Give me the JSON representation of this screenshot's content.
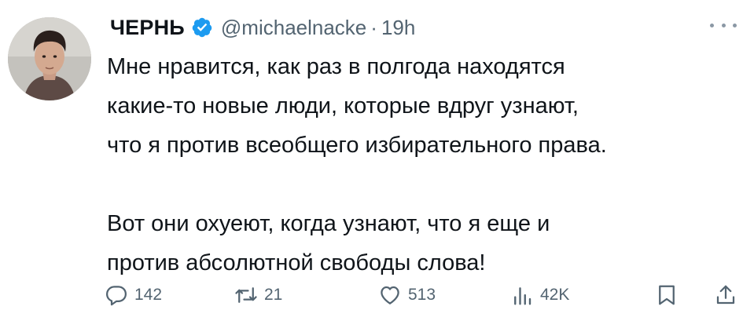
{
  "tweet": {
    "author_name": "ЧЕРНЬ",
    "handle": "@michaelnacke",
    "separator": "·",
    "time": "19h",
    "paragraphs": [
      [
        "Мне нравится, как раз в полгода находятся",
        "какие-то новые люди, которые вдруг узнают,",
        "что я против всеобщего избирательного права."
      ],
      [
        "Вот они охуеют, когда узнают, что я еще и",
        "против абсолютной свободы слова!"
      ]
    ]
  },
  "actions": {
    "replies": "142",
    "reposts": "21",
    "likes": "513",
    "views": "42K"
  },
  "icons": {
    "more": "more-icon",
    "verified": "verified-badge-icon",
    "reply": "reply-icon",
    "repost": "repost-icon",
    "like": "like-icon",
    "views": "views-icon",
    "bookmark": "bookmark-icon",
    "share": "share-icon"
  },
  "colors": {
    "verified": "#1d9bf0",
    "secondary_text": "#536471",
    "primary_text": "#0f1419"
  }
}
